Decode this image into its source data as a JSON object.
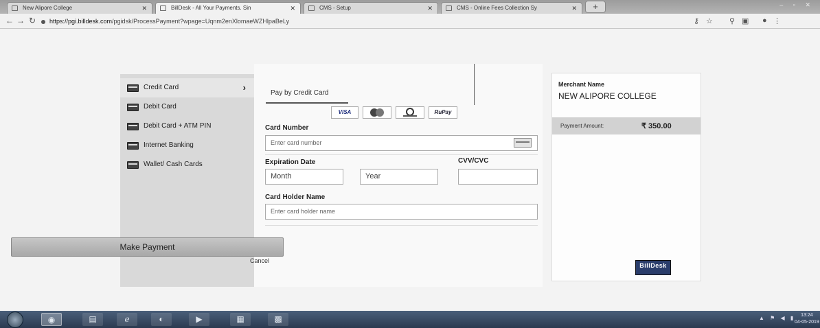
{
  "browser": {
    "tabs": [
      {
        "title": "New Alipore College"
      },
      {
        "title": "BillDesk - All Your Payments. Sin"
      },
      {
        "title": "CMS - Setup"
      },
      {
        "title": "CMS - Online Fees Collection Sy"
      }
    ],
    "new_tab": "+",
    "window_controls": "– ▫ ✕",
    "url_host": "https://pgi.billdesk.com",
    "url_path": "/pgidsk/ProcessPayment?wpage=Uqnm2enXlomaeWZHlpaBeLy"
  },
  "payment_methods": [
    {
      "label": "Credit Card",
      "icon": "credit-card-icon",
      "active": true
    },
    {
      "label": "Debit Card",
      "icon": "debit-card-icon",
      "active": false
    },
    {
      "label": "Debit Card + ATM PIN",
      "icon": "pin-card-icon",
      "active": false
    },
    {
      "label": "Internet Banking",
      "icon": "bank-icon",
      "active": false
    },
    {
      "label": "Wallet/ Cash Cards",
      "icon": "wallet-icon",
      "active": false
    }
  ],
  "form": {
    "tab_label": "Pay by Credit Card",
    "logos": [
      "VISA",
      "Mastercard",
      "Diners Club",
      "RuPay"
    ],
    "card_number_label": "Card Number",
    "card_number_placeholder": "Enter card number",
    "expiration_label": "Expiration Date",
    "month_placeholder": "Month",
    "year_placeholder": "Year",
    "cvv_label": "CVV/CVC",
    "holder_label": "Card Holder Name",
    "holder_placeholder": "Enter card holder name",
    "pay_button": "Make Payment",
    "cancel": "Cancel"
  },
  "merchant": {
    "name_label": "Merchant Name",
    "name": "NEW ALIPORE COLLEGE",
    "amount_label": "Payment Amount:",
    "amount": "₹ 350.00",
    "brand": "BillDesk"
  },
  "taskbar": {
    "clock_time": "13:24",
    "clock_date": "04-05-2019"
  }
}
